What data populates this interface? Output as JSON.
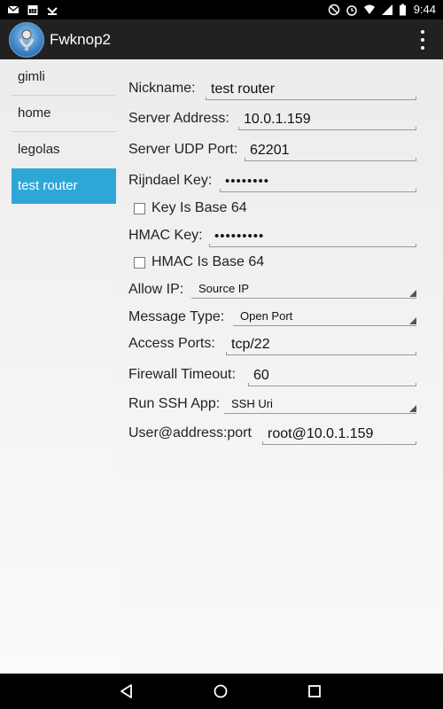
{
  "status_bar": {
    "time": "9:44",
    "left_icons": [
      "gmail-icon",
      "calendar-icon",
      "download-icon"
    ],
    "right_icons": [
      "do-not-disturb-icon",
      "alarm-icon",
      "wifi-icon",
      "signal-icon",
      "battery-icon"
    ]
  },
  "app": {
    "title": "Fwknop2"
  },
  "sidebar": {
    "items": [
      {
        "label": "gimli",
        "selected": false
      },
      {
        "label": "home",
        "selected": false
      },
      {
        "label": "legolas",
        "selected": false
      },
      {
        "label": "test router",
        "selected": true
      }
    ]
  },
  "form": {
    "nickname": {
      "label": "Nickname:",
      "value": "test router"
    },
    "server_address": {
      "label": "Server Address:",
      "value": "10.0.1.159"
    },
    "server_udp_port": {
      "label": "Server UDP Port:",
      "value": "62201"
    },
    "rijndael_key": {
      "label": "Rijndael Key:",
      "value": "••••••••"
    },
    "key_base64": {
      "label": "Key Is Base 64",
      "checked": false
    },
    "hmac_key": {
      "label": "HMAC Key:",
      "value": "•••••••••"
    },
    "hmac_base64": {
      "label": "HMAC Is Base 64",
      "checked": false
    },
    "allow_ip": {
      "label": "Allow IP:",
      "value": "Source IP"
    },
    "message_type": {
      "label": "Message Type:",
      "value": "Open Port"
    },
    "access_ports": {
      "label": "Access Ports:",
      "value": "tcp/22"
    },
    "firewall_timeout": {
      "label": "Firewall Timeout:",
      "value": "60"
    },
    "run_ssh_app": {
      "label": "Run SSH App:",
      "value": "SSH Uri"
    },
    "user_address_port": {
      "label": "User@address:port",
      "value": "root@10.0.1.159"
    }
  },
  "nav_bar": {
    "buttons": [
      "back-icon",
      "home-icon",
      "recents-icon"
    ]
  }
}
